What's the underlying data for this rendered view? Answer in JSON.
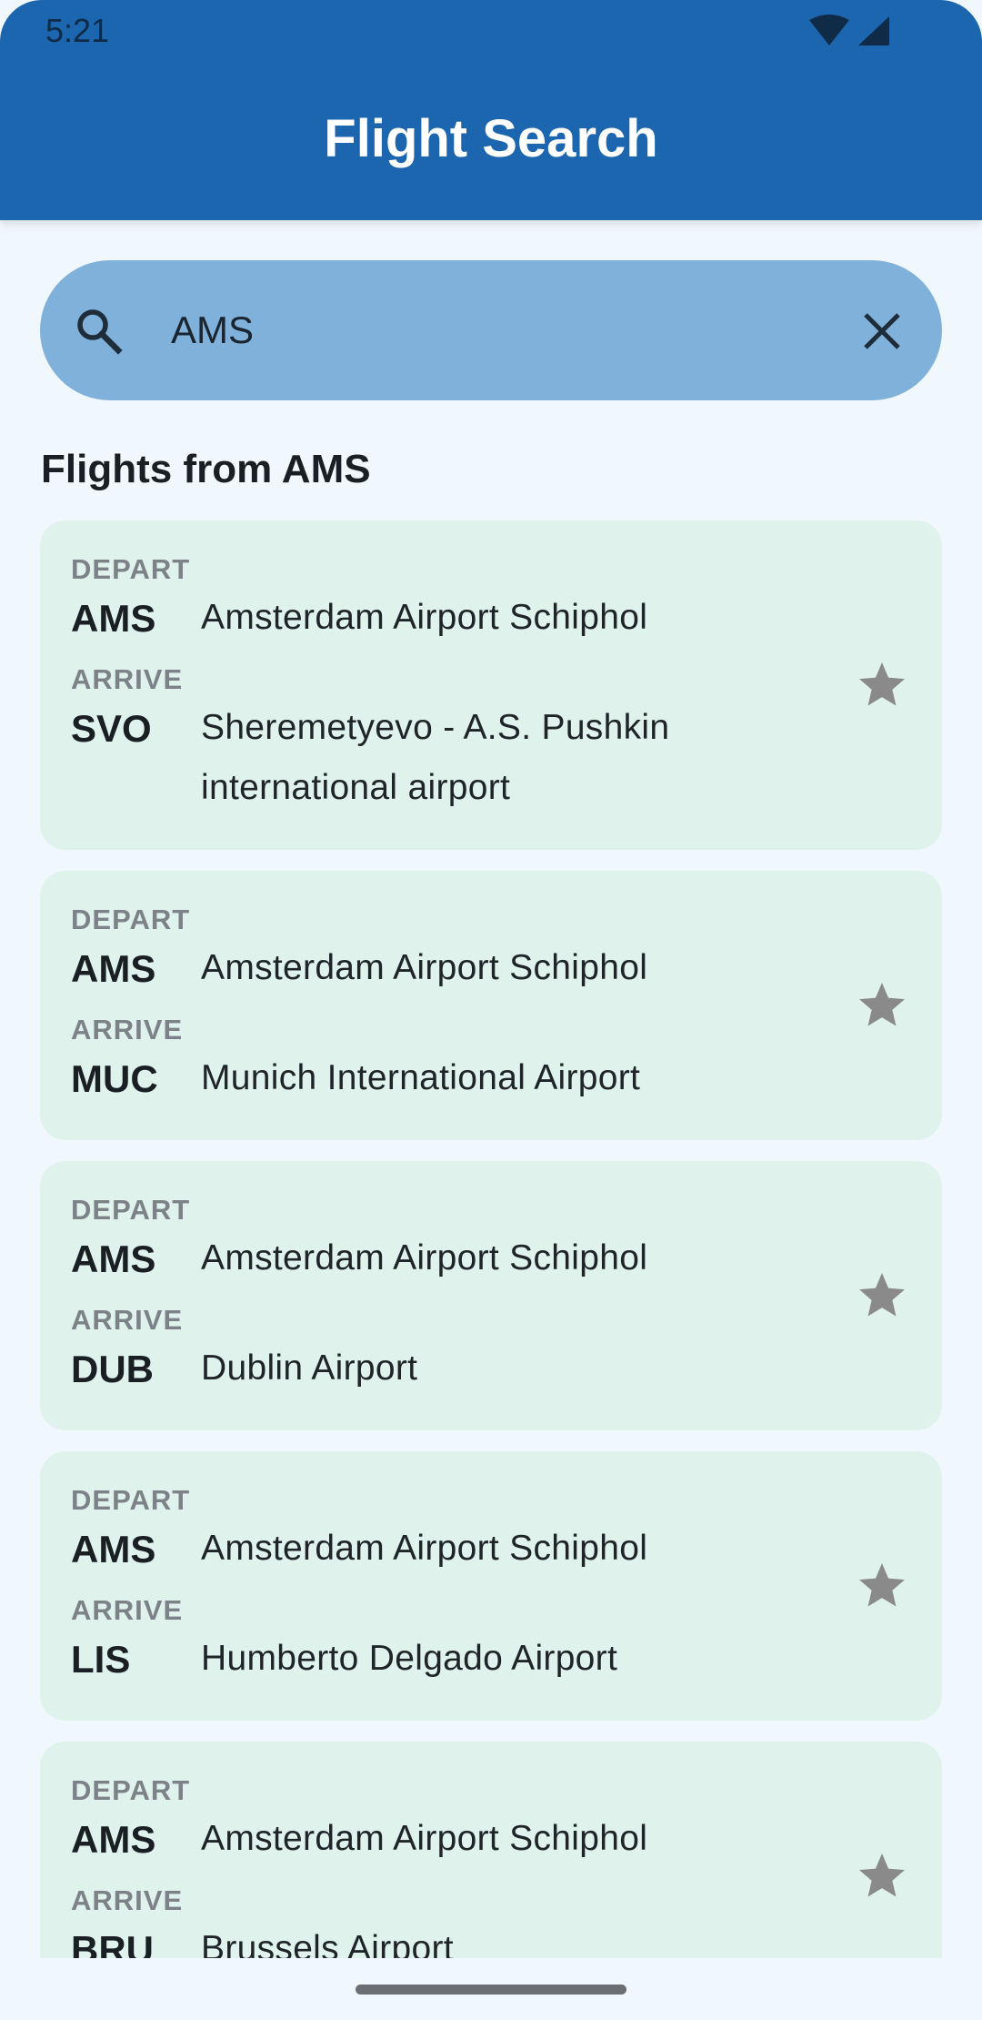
{
  "status_bar": {
    "time": "5:21"
  },
  "app_bar": {
    "title": "Flight Search"
  },
  "search": {
    "value": "AMS",
    "icon": "search-icon",
    "clear_icon": "close-icon"
  },
  "section": {
    "title": "Flights from AMS"
  },
  "labels": {
    "depart": "DEPART",
    "arrive": "ARRIVE"
  },
  "flights": [
    {
      "depart_code": "AMS",
      "depart_name": "Amsterdam Airport Schiphol",
      "arrive_code": "SVO",
      "arrive_name_line1": "Sheremetyevo - A.S. Pushkin",
      "arrive_name_line2": "international airport",
      "favorite": false
    },
    {
      "depart_code": "AMS",
      "depart_name": "Amsterdam Airport Schiphol",
      "arrive_code": "MUC",
      "arrive_name": "Munich International Airport",
      "favorite": false
    },
    {
      "depart_code": "AMS",
      "depart_name": "Amsterdam Airport Schiphol",
      "arrive_code": "DUB",
      "arrive_name": "Dublin Airport",
      "favorite": false
    },
    {
      "depart_code": "AMS",
      "depart_name": "Amsterdam Airport Schiphol",
      "arrive_code": "LIS",
      "arrive_name": "Humberto Delgado Airport",
      "favorite": false
    },
    {
      "depart_code": "AMS",
      "depart_name": "Amsterdam Airport Schiphol",
      "arrive_code": "BRU",
      "arrive_name": "Brussels Airport",
      "favorite": false
    }
  ],
  "colors": {
    "app_bar": "#1b66ae",
    "search_bar": "#80b1da",
    "card": "#dff2ec",
    "background": "#f1f8fd",
    "star": "#8a8a8a"
  }
}
